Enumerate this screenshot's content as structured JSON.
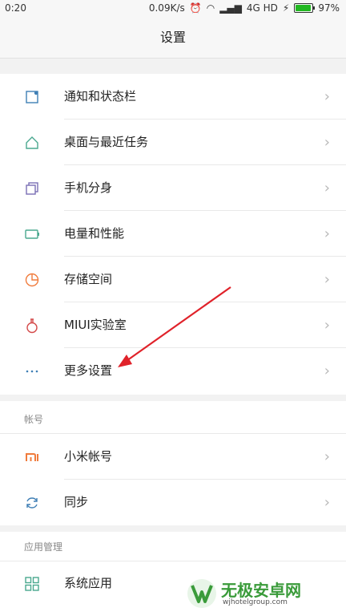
{
  "status_bar": {
    "time": "0:20",
    "speed": "0.09K/s",
    "network": "4G HD",
    "battery": "97%",
    "battery_fraction": 0.97
  },
  "title": "设置",
  "group1": {
    "items": [
      {
        "label": "通知和状态栏",
        "icon": "notification-icon"
      },
      {
        "label": "桌面与最近任务",
        "icon": "home-icon"
      },
      {
        "label": "手机分身",
        "icon": "clone-icon"
      },
      {
        "label": "电量和性能",
        "icon": "battery-icon"
      },
      {
        "label": "存储空间",
        "icon": "storage-icon"
      },
      {
        "label": "MIUI实验室",
        "icon": "flask-icon"
      },
      {
        "label": "更多设置",
        "icon": "more-dots-icon"
      }
    ]
  },
  "account_section": {
    "title": "帐号",
    "items": [
      {
        "label": "小米帐号",
        "icon": "mi-logo-icon"
      },
      {
        "label": "同步",
        "icon": "sync-icon"
      }
    ]
  },
  "app_section": {
    "title": "应用管理",
    "items": [
      {
        "label": "系统应用",
        "icon": "grid-icon"
      }
    ]
  },
  "watermark": {
    "title": "无极安卓网",
    "url": "wjhotelgroup.com"
  },
  "colors": {
    "icon_blue": "#3f7fb5",
    "icon_green": "#4aa88f",
    "icon_orange": "#f07b3c",
    "icon_red": "#d44a4a",
    "arrow_red": "#e0222a"
  }
}
